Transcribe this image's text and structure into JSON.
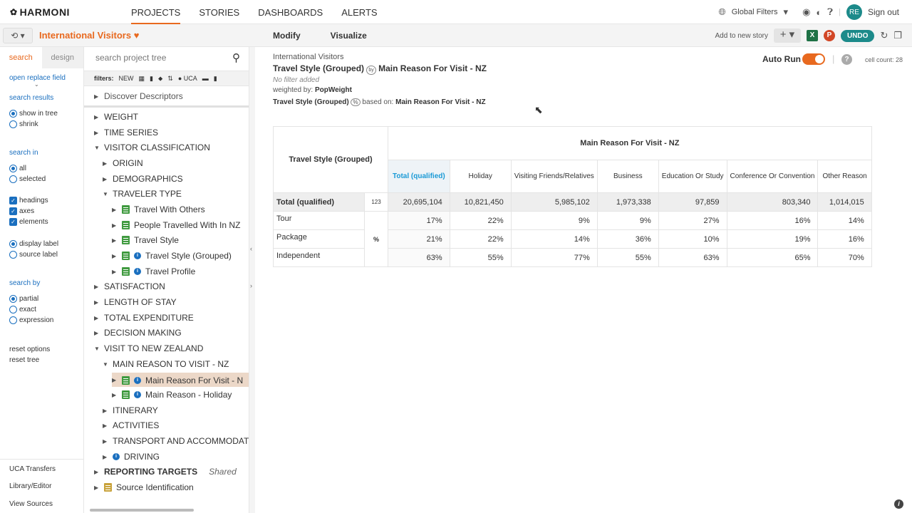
{
  "app": {
    "logo": "HARMONI"
  },
  "nav": {
    "items": [
      "PROJECTS",
      "STORIES",
      "DASHBOARDS",
      "ALERTS"
    ]
  },
  "topright": {
    "global_filters": "Global Filters",
    "avatar": "RE",
    "sign_out": "Sign out"
  },
  "subbar": {
    "project_title": "International Visitors",
    "modify": "Modify",
    "visualize": "Visualize",
    "add_to_story": "Add to new story",
    "undo": "UNDO"
  },
  "leftpanel": {
    "tab_search": "search",
    "tab_design": "design",
    "open_replace": "open replace field",
    "search_results": "search results",
    "show_in_tree": "show in tree",
    "shrink": "shrink",
    "search_in": "search in",
    "all": "all",
    "selected": "selected",
    "headings": "headings",
    "axes": "axes",
    "elements": "elements",
    "display_label": "display label",
    "source_label": "source label",
    "search_by": "search by",
    "partial": "partial",
    "exact": "exact",
    "expression": "expression",
    "reset_options": "reset options",
    "reset_tree": "reset tree",
    "uca_transfers": "UCA Transfers",
    "library_editor": "Library/Editor",
    "view_sources": "View Sources"
  },
  "tree": {
    "search_placeholder": "search project tree",
    "filters_label": "filters:",
    "filters_new": "NEW",
    "filters_uca": "UCA",
    "nodes": {
      "discover": "Discover Descriptors",
      "weight": "WEIGHT",
      "time_series": "TIME SERIES",
      "visitor_class": "VISITOR CLASSIFICATION",
      "origin": "ORIGIN",
      "demographics": "DEMOGRAPHICS",
      "traveler_type": "TRAVELER TYPE",
      "travel_with_others": "Travel With Others",
      "people_travelled": "People Travelled With In NZ",
      "travel_style": "Travel Style",
      "travel_style_grouped": "Travel Style (Grouped)",
      "travel_profile": "Travel Profile",
      "satisfaction": "SATISFACTION",
      "length_of_stay": "LENGTH OF STAY",
      "total_expenditure": "TOTAL EXPENDITURE",
      "decision_making": "DECISION MAKING",
      "visit_nz": "VISIT TO NEW ZEALAND",
      "main_reason_nz": "MAIN REASON TO VISIT - NZ",
      "main_reason_for_visit": "Main Reason For Visit - N",
      "main_reason_holiday": "Main Reason - Holiday",
      "itinerary": "ITINERARY",
      "activities": "ACTIVITIES",
      "transport": "TRANSPORT AND ACCOMMODATIO",
      "driving": "DRIVING",
      "reporting_targets": "REPORTING TARGETS",
      "shared": "Shared",
      "source_identification": "Source Identification"
    }
  },
  "main": {
    "project_name": "International Visitors",
    "row_var": "Travel Style (Grouped)",
    "by": "by",
    "col_var": "Main Reason For Visit - NZ",
    "no_filter": "No filter added",
    "weighted_by_label": "weighted by:",
    "weight": "PopWeight",
    "base_var": "Travel Style (Grouped)",
    "pct": "%",
    "based_on_label": "based on:",
    "based_on": "Main Reason For Visit - NZ",
    "auto_run": "Auto Run",
    "help": "?",
    "cell_count": "cell count: 28"
  },
  "table": {
    "row_header": "Travel Style (Grouped)",
    "col_header": "Main Reason For Visit - NZ",
    "columns": [
      "Total (qualified)",
      "Holiday",
      "Visiting Friends/Relatives",
      "Business",
      "Education Or Study",
      "Conference Or Convention",
      "Other Reason"
    ],
    "total_label": "Total (qualified)",
    "total_tag": "123",
    "totals": [
      "20,695,104",
      "10,821,450",
      "5,985,102",
      "1,973,338",
      "97,859",
      "803,340",
      "1,014,015"
    ],
    "pct_tag": "%",
    "rows": [
      {
        "label": "Tour",
        "values": [
          "17%",
          "22%",
          "9%",
          "9%",
          "27%",
          "16%",
          "14%"
        ]
      },
      {
        "label": "Package",
        "values": [
          "21%",
          "22%",
          "14%",
          "36%",
          "10%",
          "19%",
          "16%"
        ]
      },
      {
        "label": "Independent",
        "values": [
          "63%",
          "55%",
          "77%",
          "55%",
          "63%",
          "65%",
          "70%"
        ]
      }
    ]
  }
}
